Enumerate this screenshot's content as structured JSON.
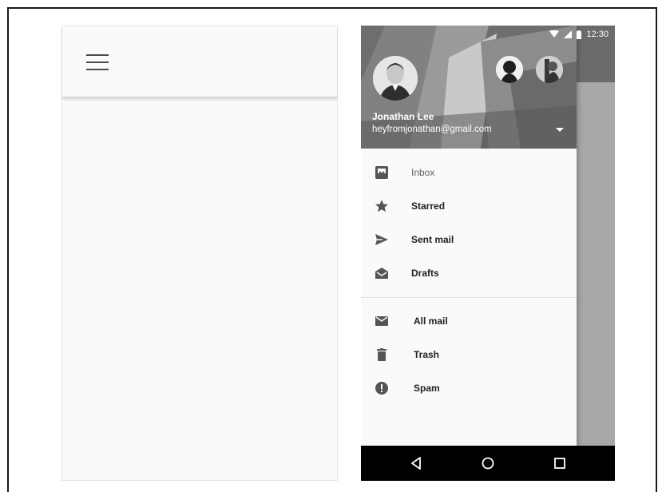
{
  "statusbar": {
    "time": "12:30",
    "icons": [
      "wifi-icon",
      "signal-icon",
      "battery-icon"
    ]
  },
  "account": {
    "name": "Jonathan Lee",
    "email": "heyfromjonathan@gmail.com"
  },
  "menu_primary": [
    {
      "label": "Inbox",
      "icon": "inbox-icon"
    },
    {
      "label": "Starred",
      "icon": "star-icon"
    },
    {
      "label": "Sent mail",
      "icon": "send-icon"
    },
    {
      "label": "Drafts",
      "icon": "drafts-icon"
    }
  ],
  "menu_secondary": [
    {
      "label": "All mail",
      "icon": "mail-icon"
    },
    {
      "label": "Trash",
      "icon": "trash-icon"
    },
    {
      "label": "Spam",
      "icon": "spam-icon"
    }
  ],
  "nav_buttons": [
    "back-icon",
    "home-icon",
    "recents-icon"
  ]
}
